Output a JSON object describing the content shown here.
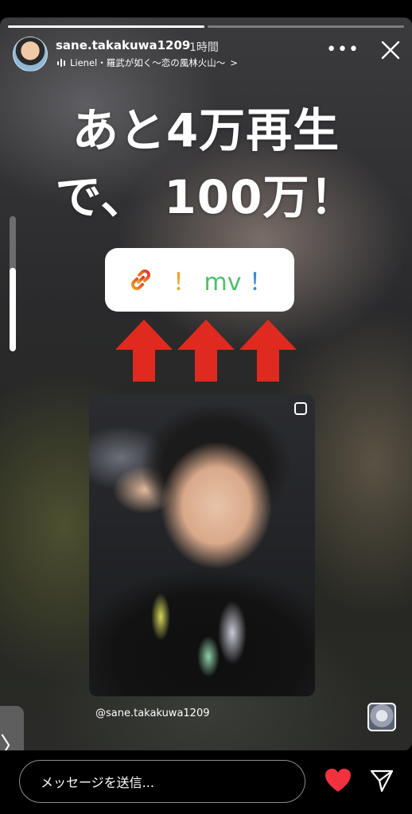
{
  "story": {
    "progress_segments": [
      {
        "state": "done"
      },
      {
        "state": "active"
      }
    ],
    "header": {
      "username": "sane.takakuwa1209",
      "time_ago": "1時間",
      "music": "Lienel・羅武が如く〜恋の風林火山〜",
      "music_chevron": ">"
    },
    "headline_line1": "あと4万再生",
    "headline_line2": "で、 100万！",
    "link_sticker": {
      "icon": "link-icon",
      "ex1": "！",
      "mv": "mv",
      "ex2": "！",
      "colors": {
        "icon": "#e8512b",
        "ex1": "#f0a020",
        "mv": "#4cc16a",
        "ex2": "#2f8de4"
      }
    },
    "arrow_color": "#e02a1f",
    "arrow_count": 3,
    "volume_level": 0.62,
    "mention": "@sane.takakuwa1209",
    "side_tab_glyph": "〉"
  },
  "bottom_bar": {
    "message_placeholder": "メッセージを送信...",
    "heart_color": "#f0323e"
  },
  "icons": [
    "more-icon",
    "close-icon",
    "music-bars-icon",
    "link-icon",
    "copy-icon",
    "heart-icon",
    "send-icon"
  ]
}
